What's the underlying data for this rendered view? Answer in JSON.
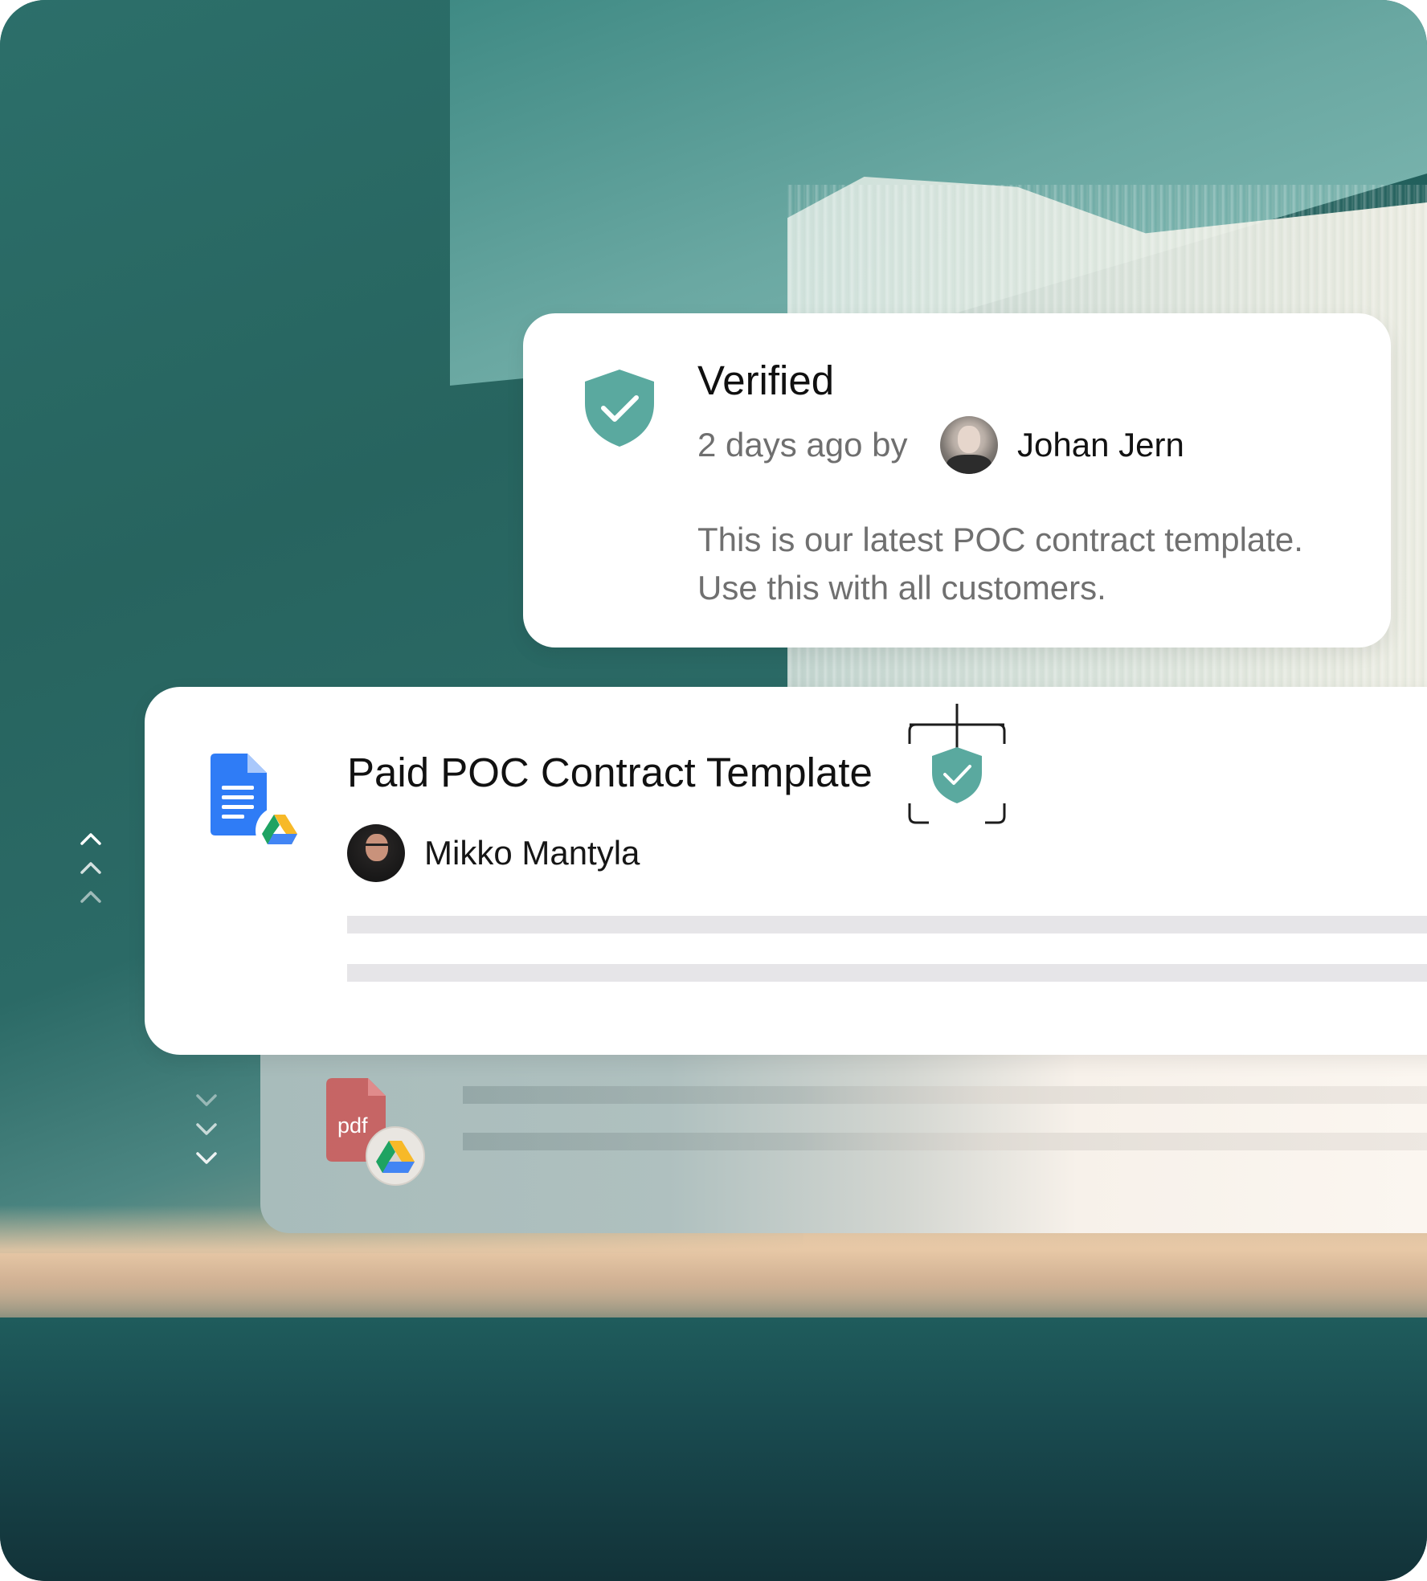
{
  "verified_card": {
    "title": "Verified",
    "meta": "2 days ago by",
    "author": "Johan Jern",
    "description": "This is our latest POC contract template. Use this with all customers."
  },
  "document_card": {
    "title": "Paid POC Contract Template",
    "author": "Mikko Mantyla"
  },
  "pdf_card": {
    "icon_label": "pdf"
  },
  "icons": {
    "verified_shield": "shield-check-icon",
    "doc": "google-docs-icon",
    "drive": "google-drive-icon",
    "pdf": "pdf-file-icon",
    "verify_target": "verify-target-icon",
    "chevrons_up": "chevron-up-icon",
    "chevrons_down": "chevron-down-icon"
  },
  "colors": {
    "accent_teal": "#5aa99f",
    "skeleton": "#e6e5e8",
    "docs_blue": "#2f7cf6",
    "pdf_red": "#c95b5b"
  }
}
